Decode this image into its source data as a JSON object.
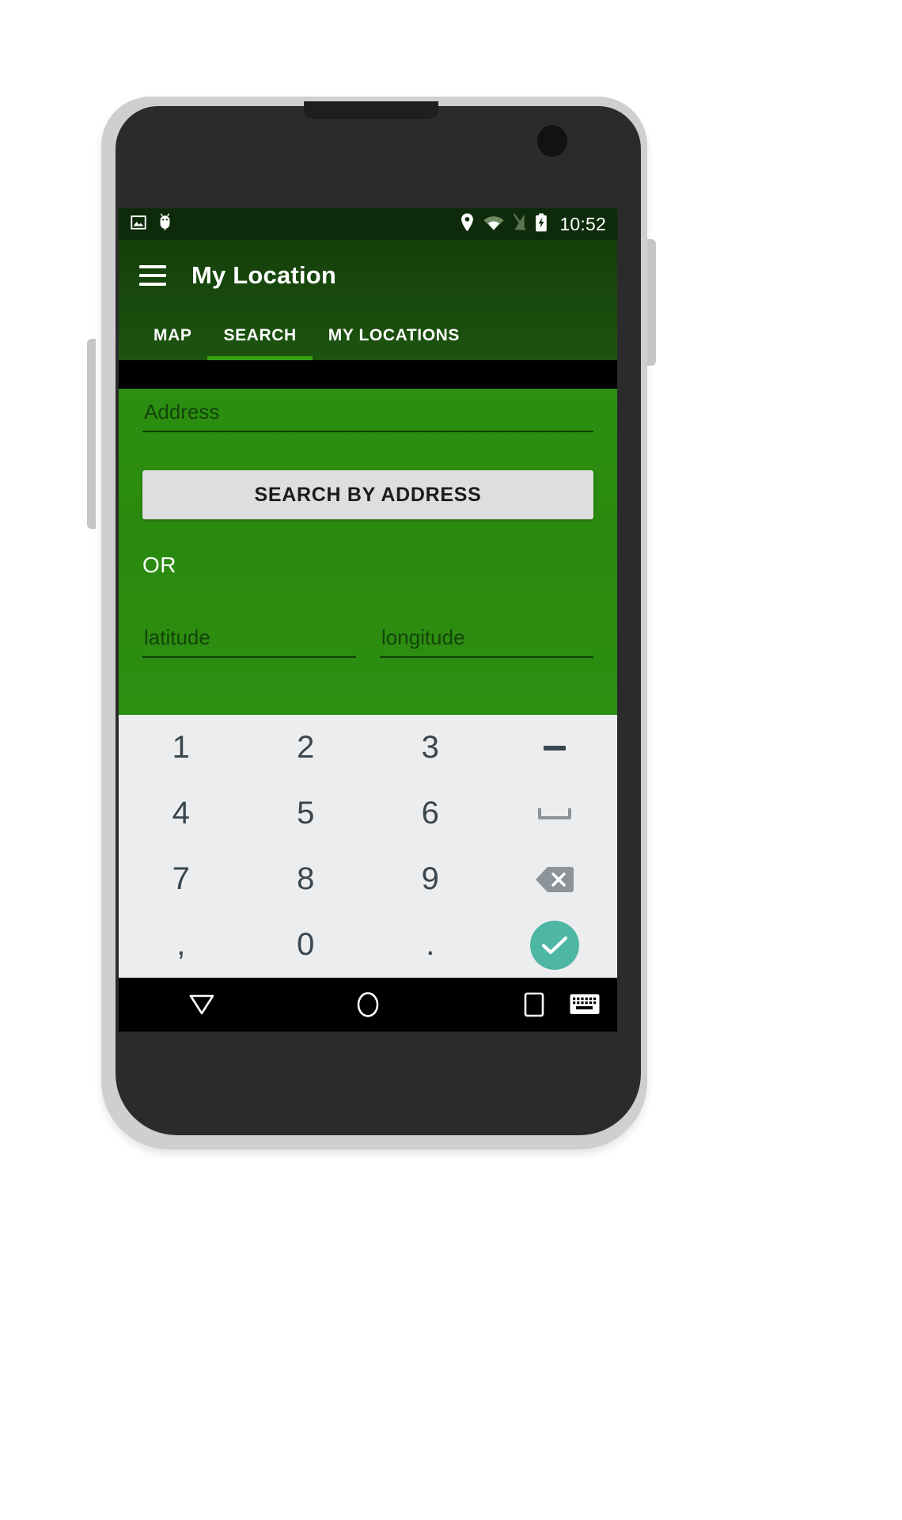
{
  "device": {
    "name": "android-phone-mockup",
    "frame_color": "#cfcfcf",
    "body_color": "#2b2b2b"
  },
  "statusbar": {
    "time": "10:52",
    "left_icons": [
      "image-icon",
      "android-debug-icon"
    ],
    "right_icons": [
      "location-pin-icon",
      "wifi-icon",
      "signal-off-icon",
      "battery-charging-icon"
    ],
    "background": "#0d2b0a"
  },
  "appbar": {
    "menu_icon": "hamburger-menu-icon",
    "title": "My Location",
    "background": "#1b4d0d",
    "accent": "#35a214"
  },
  "tabs": [
    {
      "label": "MAP",
      "active": false
    },
    {
      "label": "SEARCH",
      "active": true
    },
    {
      "label": "MY LOCATIONS",
      "active": false
    }
  ],
  "form": {
    "background": "#2a8a0f",
    "address": {
      "placeholder": "Address",
      "value": ""
    },
    "search_button": {
      "label": "SEARCH BY ADDRESS",
      "background": "#dedede",
      "text_color": "#1c1c1c"
    },
    "divider_label": "OR",
    "latitude": {
      "placeholder": "latitude",
      "value": ""
    },
    "longitude": {
      "placeholder": "longitude",
      "value": ""
    }
  },
  "keyboard": {
    "background": "#ecedef",
    "key_color": "#39464e",
    "enter_color": "#4db6a4",
    "backspace_color": "#8d9499",
    "keys": [
      {
        "label": "1",
        "name": "key-1",
        "type": "digit"
      },
      {
        "label": "2",
        "name": "key-2",
        "type": "digit"
      },
      {
        "label": "3",
        "name": "key-3",
        "type": "digit"
      },
      {
        "label": "",
        "name": "key-minus",
        "type": "minus"
      },
      {
        "label": "4",
        "name": "key-4",
        "type": "digit"
      },
      {
        "label": "5",
        "name": "key-5",
        "type": "digit"
      },
      {
        "label": "6",
        "name": "key-6",
        "type": "digit"
      },
      {
        "label": "",
        "name": "key-space",
        "type": "space"
      },
      {
        "label": "7",
        "name": "key-7",
        "type": "digit"
      },
      {
        "label": "8",
        "name": "key-8",
        "type": "digit"
      },
      {
        "label": "9",
        "name": "key-9",
        "type": "digit"
      },
      {
        "label": "",
        "name": "key-backspace",
        "type": "backspace"
      },
      {
        "label": ",",
        "name": "key-comma",
        "type": "punct"
      },
      {
        "label": "0",
        "name": "key-0",
        "type": "digit"
      },
      {
        "label": ".",
        "name": "key-period",
        "type": "punct"
      },
      {
        "label": "",
        "name": "key-enter",
        "type": "enter"
      }
    ]
  },
  "navbar": {
    "background": "#000000",
    "buttons": [
      "back-icon",
      "home-icon",
      "recents-icon"
    ],
    "keyboard_indicator": "keyboard-icon"
  }
}
